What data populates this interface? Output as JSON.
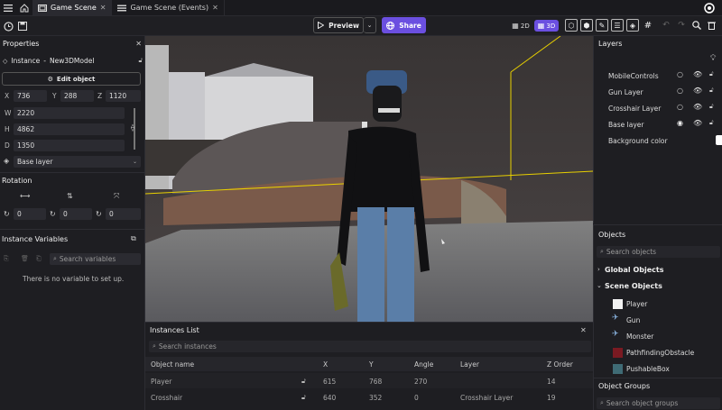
{
  "tabs": [
    {
      "label": "Game Scene"
    },
    {
      "label": "Game Scene (Events)"
    }
  ],
  "toolbar": {
    "preview_label": "Preview",
    "share_label": "Share",
    "mode_2d": "2D",
    "mode_3d": "3D"
  },
  "properties": {
    "title": "Properties",
    "instance_label": "Instance",
    "instance_name": "New3DModel",
    "edit_object": "Edit object",
    "x_label": "X",
    "x": "736",
    "y_label": "Y",
    "y": "288",
    "z_label": "Z",
    "z": "1120",
    "w_label": "W",
    "w": "2220",
    "h_label": "H",
    "h": "4862",
    "d_label": "D",
    "d": "1350",
    "layer": "Base layer",
    "rotation_title": "Rotation",
    "rot_x": "0",
    "rot_y": "0",
    "rot_z": "0"
  },
  "variables": {
    "title": "Instance Variables",
    "search_placeholder": "Search variables",
    "empty_text": "There is no variable to set up."
  },
  "layers": {
    "title": "Layers",
    "items": [
      {
        "name": "MobileControls",
        "selected": false
      },
      {
        "name": "Gun Layer",
        "selected": false
      },
      {
        "name": "Crosshair Layer",
        "selected": false
      },
      {
        "name": "Base layer",
        "selected": true
      }
    ],
    "background_label": "Background color"
  },
  "objects": {
    "title": "Objects",
    "search_placeholder": "Search objects",
    "global_label": "Global Objects",
    "scene_label": "Scene Objects",
    "items": [
      {
        "name": "Player",
        "icon": "player-icon"
      },
      {
        "name": "Gun",
        "icon": "3d-model-icon"
      },
      {
        "name": "Monster",
        "icon": "3d-model-icon"
      },
      {
        "name": "PathfindingObstacle",
        "icon": "sprite-icon"
      },
      {
        "name": "PushableBox",
        "icon": "sprite-icon"
      }
    ]
  },
  "object_groups": {
    "title": "Object Groups",
    "search_placeholder": "Search object groups"
  },
  "instances": {
    "title": "Instances List",
    "search_placeholder": "Search instances",
    "columns": [
      "Object name",
      "X",
      "Y",
      "Angle",
      "Layer",
      "Z Order"
    ],
    "rows": [
      {
        "name": "Player",
        "x": "615",
        "y": "768",
        "angle": "270",
        "layer": "",
        "z": "14"
      },
      {
        "name": "Crosshair",
        "x": "640",
        "y": "352",
        "angle": "0",
        "layer": "Crosshair Layer",
        "z": "19"
      }
    ]
  },
  "colors": {
    "accent": "#6b4fe0",
    "obstacle": "#7a1a22",
    "box": "#3f6b75"
  }
}
